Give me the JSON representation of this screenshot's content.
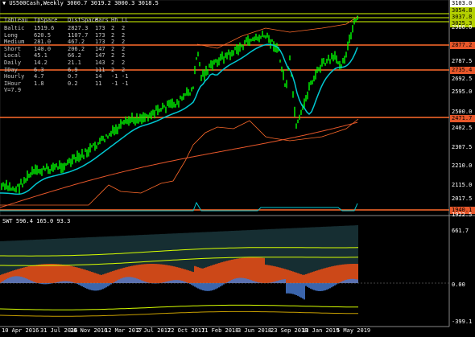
{
  "header": {
    "symbol_line": "▼ US500Cash,Weekly  3000.7 3019.2 3000.3 3018.5"
  },
  "table": {
    "headers": [
      "Tableau",
      "TpSpace",
      "DistSpace",
      "Bars",
      "Hh",
      "LL"
    ],
    "rows": [
      [
        "Baltic",
        "1519.6",
        "2827.3",
        "173",
        "2",
        "2"
      ],
      [
        "Long",
        "620.5",
        "1107.7",
        "173",
        "2",
        "2"
      ],
      [
        "Medium",
        "281.0",
        "467.2",
        "173",
        "2",
        "2"
      ],
      [
        "Short",
        "140.0",
        "206.2",
        "147",
        "2",
        "2"
      ],
      [
        "Local",
        "45.1",
        "66.2",
        "147",
        "2",
        "2"
      ],
      [
        "Daily",
        "14.2",
        "21.1",
        "143",
        "2",
        "2"
      ],
      [
        "IDay",
        "6.3",
        "6.9",
        "111",
        "2",
        "2"
      ],
      [
        "Hourly",
        "4.7",
        "0.7",
        "14",
        "-1",
        "-1"
      ],
      [
        "IHour",
        "1.8",
        "0.2",
        "11",
        "-1",
        "-1"
      ]
    ],
    "footer": "V=7.9"
  },
  "price_axis": {
    "labels": [
      {
        "text": "3103.0",
        "style": "tag-w"
      },
      {
        "text": "3054.8",
        "style": "tag-y"
      },
      {
        "text": "3037.8",
        "style": "tag-y"
      },
      {
        "text": "3025.3",
        "style": "tag-y"
      },
      {
        "text": "2980.0",
        "style": "plain"
      },
      {
        "text": "2877.2",
        "style": "tag"
      },
      {
        "text": "2787.5",
        "style": "plain"
      },
      {
        "text": "2735.4",
        "style": "tag"
      },
      {
        "text": "2692.5",
        "style": "plain"
      },
      {
        "text": "2595.0",
        "style": "plain"
      },
      {
        "text": "2500.0",
        "style": "plain"
      },
      {
        "text": "2471.7",
        "style": "tag"
      },
      {
        "text": "2402.5",
        "style": "plain"
      },
      {
        "text": "2307.5",
        "style": "plain"
      },
      {
        "text": "2210.0",
        "style": "plain"
      },
      {
        "text": "2115.0",
        "style": "plain"
      },
      {
        "text": "2017.5",
        "style": "plain"
      },
      {
        "text": "1940.1",
        "style": "tag"
      },
      {
        "text": "1922.5",
        "style": "plain"
      }
    ]
  },
  "indicator": {
    "title": "SWT 596.4 165.0 93.3",
    "labels": [
      "661.7",
      "0.00",
      "-399.1"
    ]
  },
  "time_axis": {
    "labels": [
      "10 Apr 2016",
      "31 Jul 2016",
      "20 Nov 2016",
      "12 Mar 2017",
      "2 Jul 2017",
      "22 Oct 2017",
      "11 Feb 2018",
      "3 Jun 2018",
      "23 Sep 2018",
      "13 Jan 2019",
      "5 May 2019"
    ]
  },
  "colors": {
    "background": "#000000",
    "candles": "#00ff00",
    "ma_fast": "#00c8d2",
    "ma_slow": "#e8572a",
    "level_orange": "#ff6a2a",
    "level_yellow": "#d8ff00",
    "hist_fill": "#ff5a1e",
    "hist_blue": "#4a7fd8",
    "hist_cyan": "#4fa8b8"
  }
}
